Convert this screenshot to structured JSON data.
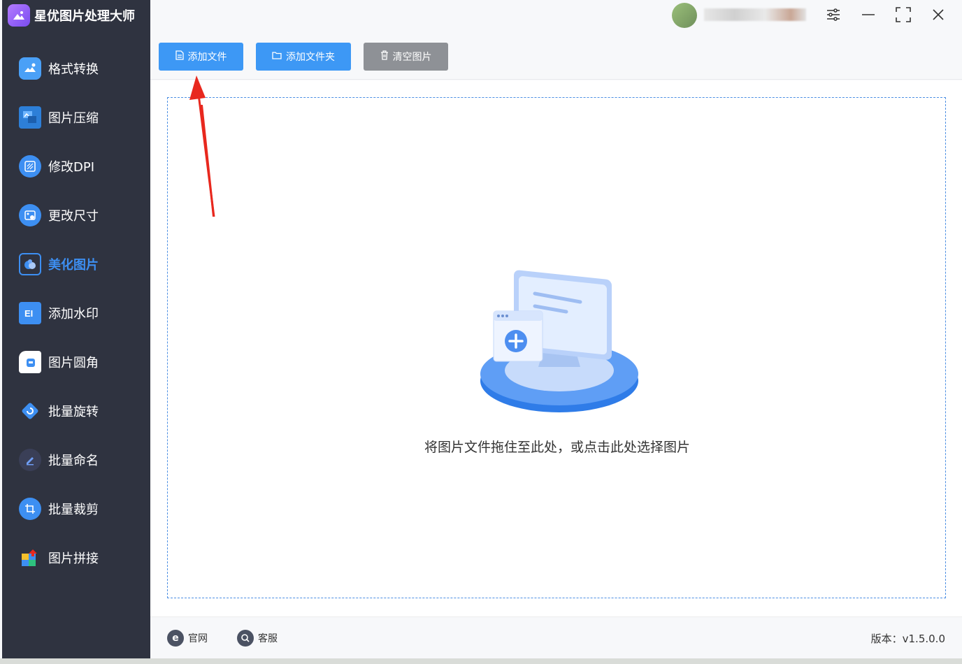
{
  "app": {
    "title": "星优图片处理大师"
  },
  "sidebar": {
    "items": [
      {
        "label": "格式转换",
        "icon": "image-convert-icon",
        "color": "#3d8ff2",
        "active": false
      },
      {
        "label": "图片压缩",
        "icon": "image-compress-icon",
        "color": "#3d8ff2",
        "active": false
      },
      {
        "label": "修改DPI",
        "icon": "dpi-icon",
        "color": "#3d8ff2",
        "active": false
      },
      {
        "label": "更改尺寸",
        "icon": "resize-icon",
        "color": "#3d8ff2",
        "active": false
      },
      {
        "label": "美化图片",
        "icon": "beautify-icon",
        "color": "#3d8ff2",
        "active": true
      },
      {
        "label": "添加水印",
        "icon": "watermark-icon",
        "color": "#3d8ff2",
        "active": false
      },
      {
        "label": "图片圆角",
        "icon": "round-corner-icon",
        "color": "#3d8ff2",
        "active": false
      },
      {
        "label": "批量旋转",
        "icon": "rotate-icon",
        "color": "#3d8ff2",
        "active": false
      },
      {
        "label": "批量命名",
        "icon": "rename-icon",
        "color": "#4a4f66",
        "active": false
      },
      {
        "label": "批量裁剪",
        "icon": "crop-icon",
        "color": "#3d8ff2",
        "active": false
      },
      {
        "label": "图片拼接",
        "icon": "puzzle-icon",
        "color": "#3d8ff2",
        "active": false
      }
    ]
  },
  "toolbar": {
    "add_file_label": "添加文件",
    "add_folder_label": "添加文件夹",
    "clear_label": "清空图片"
  },
  "dropzone": {
    "hint": "将图片文件拖住至此处，或点击此处选择图片"
  },
  "footer": {
    "website_label": "官网",
    "support_label": "客服",
    "version": "版本：v1.5.0.0"
  },
  "colors": {
    "sidebar_bg": "#2f3340",
    "accent": "#3d98f5",
    "clear_button": "#8e9196",
    "annotation_arrow": "#e8281e"
  }
}
